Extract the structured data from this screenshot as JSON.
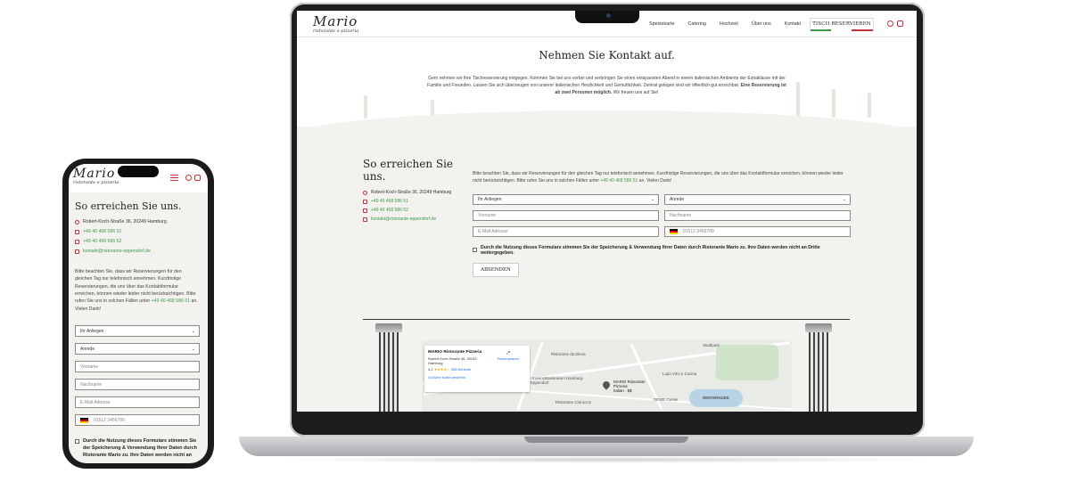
{
  "brand": {
    "logo_main": "Mario",
    "logo_sub": "ristorante e pizzeria",
    "accent_red": "#c8323a",
    "accent_green": "#3c9a4a"
  },
  "nav": {
    "links": [
      "Speisekarte",
      "Catering",
      "Hochzeit",
      "Über uns",
      "Kontakt"
    ],
    "cta": "TISCH RESERVIEREN",
    "icons": [
      "phone-icon",
      "mail-icon"
    ]
  },
  "hero": {
    "title": "Nehmen Sie Kontakt auf.",
    "text": "Gern nehmen wir Ihre Tischreservierung entgegen. Kommen Sie bei uns vorbei und verbringen Sie einen entspannten Abend in einem italienischen Ambiente der Extraklasse mit der Familie und Freunden. Lassen Sie sich überzeugen von unserer italienischen Herzlichkeit und Gemütlichkeit. Zentral gelegen sind wir öffentlich gut erreichbar.",
    "text_bold": "Eine Reservierung ist ab zwei Personen möglich.",
    "text_end": "Wir freuen uns auf Sie!"
  },
  "contact": {
    "heading": "So erreichen Sie uns.",
    "address": "Robert-Koch-Straße 36, 20249 Hamburg",
    "phone1": "+49 40 468 586 51",
    "phone2": "+49 40 468 586 52",
    "email": "kontakt@ristorante-eppendorf.de"
  },
  "note": {
    "text": "Bitte beachten Sie, dass wir Reservierungen für den gleichen Tag nur telefonisch annehmen. Kurzfristige Reservierungen, die uns über das Kontaktformular erreichen, können wieder leider nicht berücksichtigen. Bitte rufen Sie uns in solchen Fällen unter",
    "phone": "+49 40 468 586 51",
    "end": "an. Vielen Dank!"
  },
  "form": {
    "anliegen": "Ihr Anliegen",
    "anrede": "Anrede",
    "vorname": "Vorname",
    "nachname": "Nachname",
    "email": "E-Mail Adresse",
    "phone_placeholder": "01512 3456789",
    "consent": "Durch die Nutzung dieses Formulars stimmen Sie der Speicherung & Verwendung Ihrer Daten durch Ristorante Mario zu. Ihre Daten werden nicht an Dritte weitergegeben.",
    "submit": "ABSENDEN"
  },
  "map": {
    "place_name": "MARIO Ristorante Pizzeria",
    "place_address": "Robert-Koch-Straße 36, 20249 Hamburg",
    "rating": "4,2",
    "stars": "★★★★☆",
    "reviews": "355 Berichte",
    "larger_map": "Größere Karte ansehen",
    "route": "Routenplaner",
    "labels": {
      "stadtpark": "Stadtpark",
      "winterhude": "WINTERHUDE",
      "elena": "Ristorante da Elena",
      "klinikum": "Universitätsklinikum Hamburg-Eppendorf",
      "pin_label": "MARIO Ristorante Pizzeria",
      "pin_label_sub": "Italian · $$",
      "lupo": "Lupo Vino e Cucina",
      "rewe": "REWE Center",
      "carlito": "Ristorante Carruccio"
    }
  },
  "phone": {
    "phone1": "+49 40 468 586 51",
    "phone2": "+49 40 468 586 52",
    "note_l1": "Bitte beachten Sie, dass wir Reservierungen für den gleichen Tag nur telefonisch annehmen. Kurzfristige Reservierungen, die uns über das Kontaktformular erreichen, können wieder leider nicht berücksichtigen. Bitte rufen Sie uns in solchen Fällen unter",
    "note_phone": "+49 40 468 586 51",
    "note_end": "an. Vielen Dank!",
    "consent": "Durch die Nutzung dieses Formulars stimmen Sie der Speicherung & Verwendung Ihrer Daten durch Ristorante Mario zu. Ihre Daten werden nicht an"
  }
}
